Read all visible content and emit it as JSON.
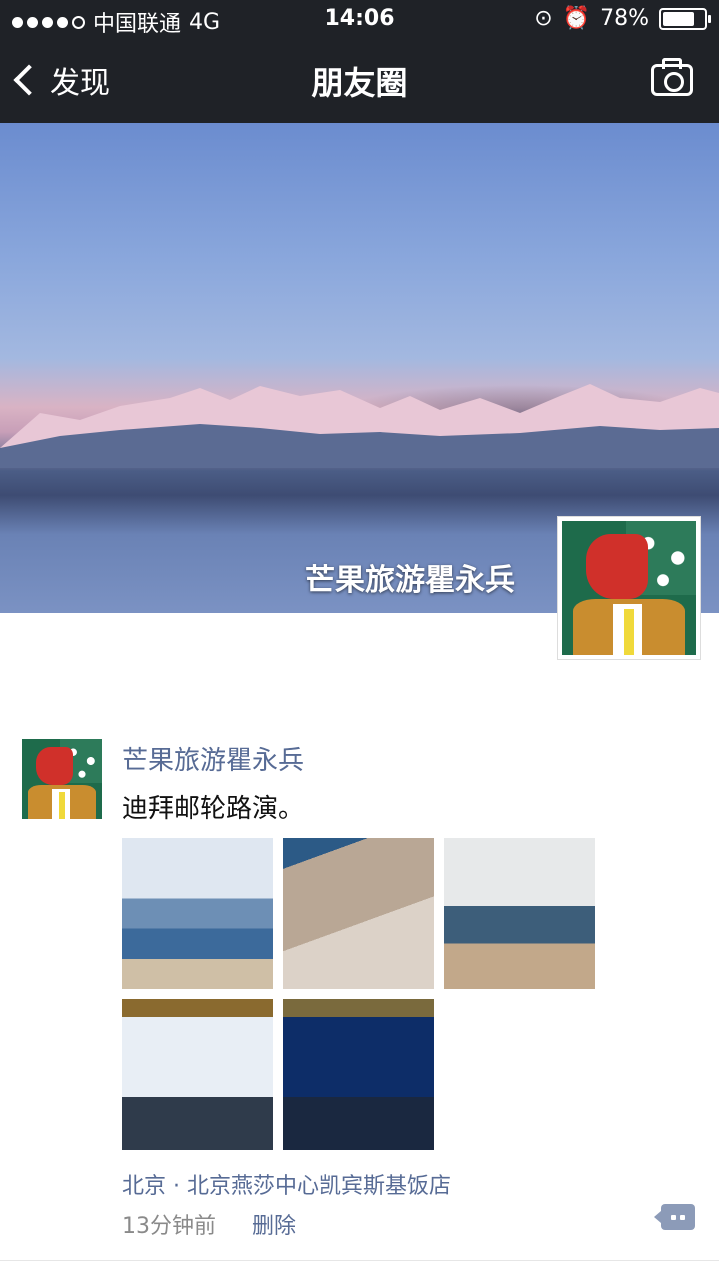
{
  "status_bar": {
    "carrier": "中国联通",
    "network": "4G",
    "time": "14:06",
    "battery": "78%",
    "battery_level": 0.78
  },
  "nav": {
    "back_label": "发现",
    "title": "朋友圈"
  },
  "cover": {
    "username": "芒果旅游瞿永兵"
  },
  "post": {
    "author": "芒果旅游瞿永兵",
    "text": "迪拜邮轮路演。",
    "location": "北京 · 北京燕莎中心凯宾斯基饭店",
    "time_ago": "13分钟前",
    "delete_label": "删除"
  },
  "colors": {
    "nav_bg": "#1f2227",
    "link": "#576b95",
    "meta": "#8a8a8a"
  }
}
